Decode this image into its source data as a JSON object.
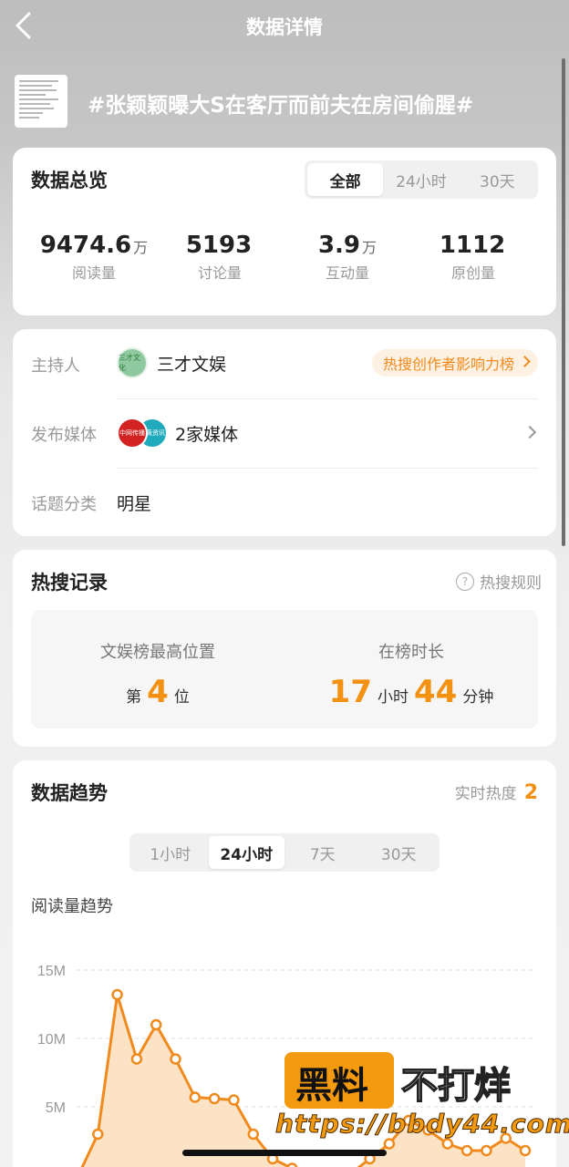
{
  "nav": {
    "title": "数据详情"
  },
  "topic": {
    "title": "#张颖颖曝大S在客厅而前夫在房间偷腥#"
  },
  "overview": {
    "title": "数据总览",
    "tabs": [
      "全部",
      "24小时",
      "30天"
    ],
    "active_tab": 0,
    "stats": [
      {
        "value": "9474.6",
        "unit": "万",
        "label": "阅读量"
      },
      {
        "value": "5193",
        "unit": "",
        "label": "讨论量"
      },
      {
        "value": "3.9",
        "unit": "万",
        "label": "互动量"
      },
      {
        "value": "1112",
        "unit": "",
        "label": "原创量"
      }
    ]
  },
  "info": {
    "host_label": "主持人",
    "host_avatar_text": "三才文化",
    "host_name": "三才文娱",
    "rank_link": "热搜创作者影响力榜",
    "media_label": "发布媒体",
    "media_a_text": "中网传播",
    "media_b_text": "蛋黄资讯",
    "media_value": "2家媒体",
    "category_label": "话题分类",
    "category_value": "明星"
  },
  "hot": {
    "title": "热搜记录",
    "rule_link": "热搜规则",
    "peak_label": "文娱榜最高位置",
    "peak_prefix": "第",
    "peak_value": "4",
    "peak_suffix": "位",
    "duration_label": "在榜时长",
    "hours": "17",
    "hours_unit": "小时",
    "minutes": "44",
    "minutes_unit": "分钟"
  },
  "trend": {
    "title": "数据趋势",
    "realtime_label": "实时热度",
    "realtime_value": "2",
    "tabs": [
      "1小时",
      "24小时",
      "7天",
      "30天"
    ],
    "active_tab": 1,
    "subtitle": "阅读量趋势"
  },
  "watermark": {
    "brand_a": "黑料",
    "brand_b": "不打烊",
    "url": "https://bbdy44.com"
  },
  "colors": {
    "accent": "#f29112",
    "line": "#f08a1c",
    "fill": "#fbd9b3"
  },
  "chart_data": {
    "type": "line",
    "title": "阅读量趋势",
    "x": [
      0,
      1,
      2,
      3,
      4,
      5,
      6,
      7,
      8,
      9,
      10,
      11,
      12,
      13,
      14,
      15,
      16,
      17,
      18,
      19,
      20,
      21,
      22,
      23
    ],
    "values": [
      0,
      3000000,
      13200000,
      8500000,
      11000000,
      8500000,
      5700000,
      5600000,
      5500000,
      3000000,
      1200000,
      500000,
      100000,
      100000,
      100000,
      1200000,
      2300000,
      4000000,
      3300000,
      2300000,
      1800000,
      1800000,
      2700000,
      1800000
    ],
    "y_ticks": [
      "15M",
      "10M",
      "5M"
    ],
    "ylim": [
      0,
      15000000
    ],
    "grid": true
  }
}
